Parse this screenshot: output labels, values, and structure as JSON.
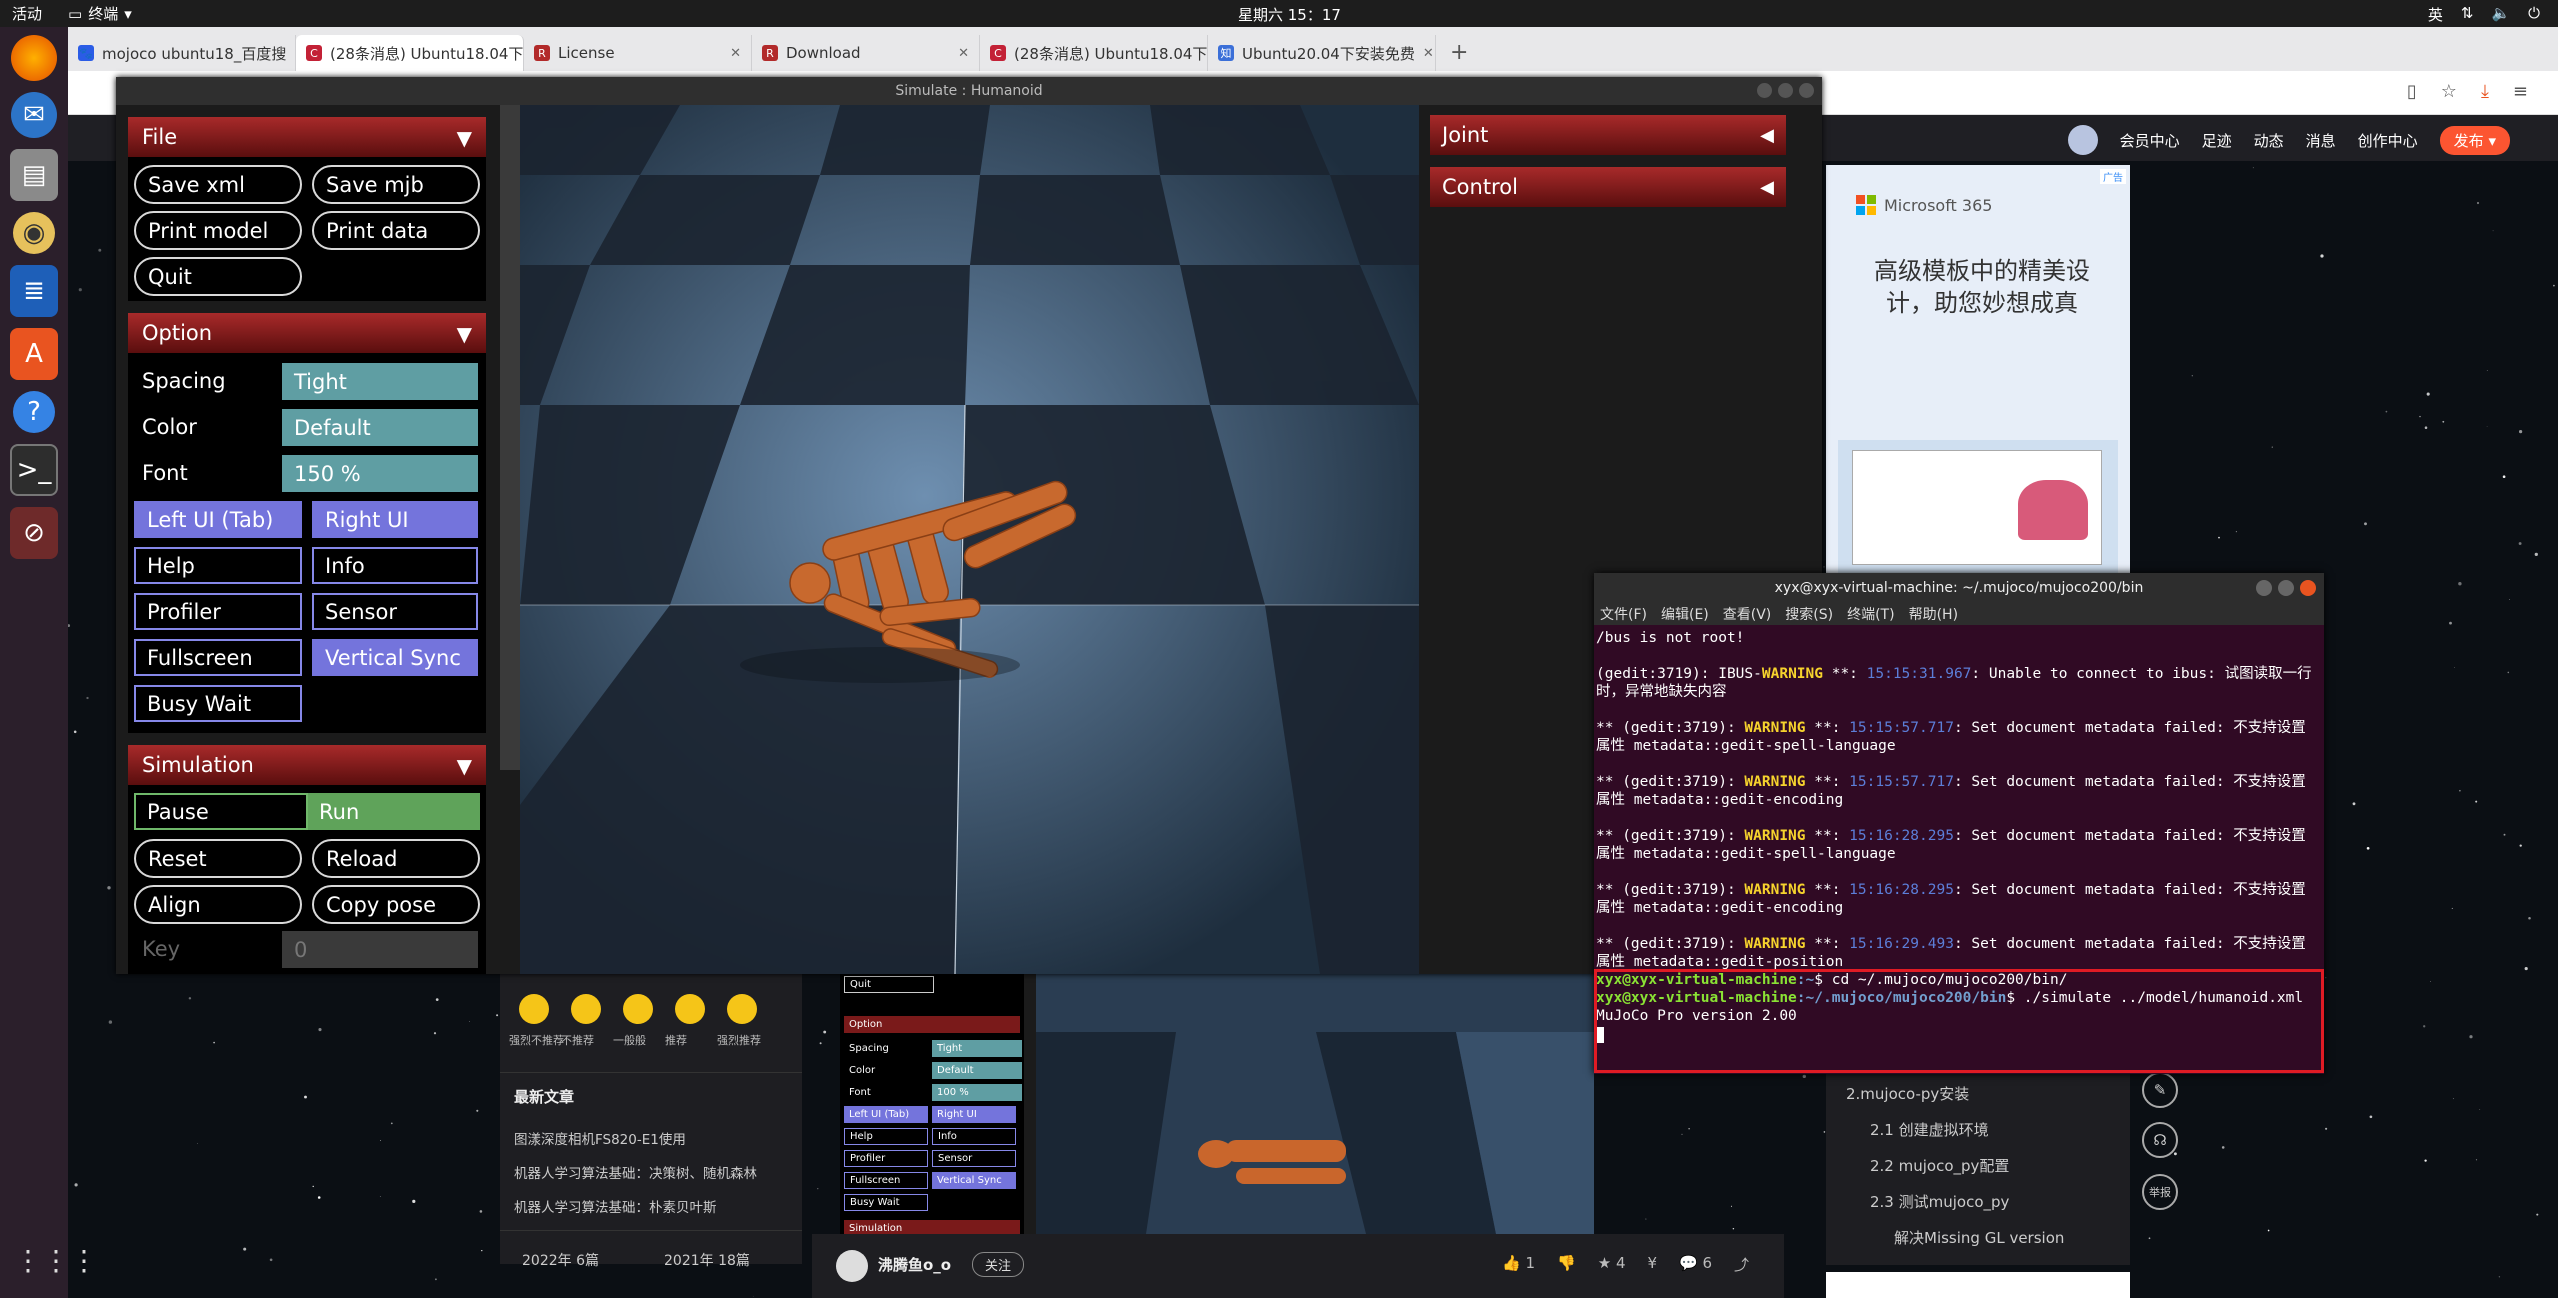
{
  "topbar": {
    "activities": "活动",
    "terminal_app": "终端",
    "clock": "星期六 15：17",
    "ime": "英"
  },
  "browser": {
    "tabs": [
      {
        "label": "mojoco ubuntu18_百度搜",
        "fav_color": "#2b5ce6",
        "fav": "🐾"
      },
      {
        "label": "(28条消息) Ubuntu18.04下",
        "fav_color": "#c32136",
        "fav": "C",
        "active": true
      },
      {
        "label": "License",
        "fav_color": "#b22a2a",
        "fav": "R"
      },
      {
        "label": "Download",
        "fav_color": "#b22a2a",
        "fav": "R"
      },
      {
        "label": "(28条消息) Ubuntu18.04下",
        "fav_color": "#c32136",
        "fav": "C"
      },
      {
        "label": "Ubuntu20.04下安装免费",
        "fav_color": "#3b6fd8",
        "fav": "知"
      }
    ]
  },
  "csdn": {
    "nav": [
      "会员中心",
      "足迹",
      "动态",
      "消息",
      "创作中心"
    ],
    "publish": "发布"
  },
  "sim": {
    "title": "Simulate : Humanoid",
    "file": {
      "header": "File",
      "buttons": [
        "Save xml",
        "Save mjb",
        "Print model",
        "Print data",
        "Quit"
      ]
    },
    "option": {
      "header": "Option",
      "rows": [
        {
          "label": "Spacing",
          "value": "Tight"
        },
        {
          "label": "Color",
          "value": "Default"
        },
        {
          "label": "Font",
          "value": "150 %"
        }
      ],
      "toggles": [
        "Left UI (Tab)",
        "Right UI",
        "Help",
        "Info",
        "Profiler",
        "Sensor",
        "Fullscreen",
        "Vertical Sync",
        "Busy Wait"
      ]
    },
    "simulation": {
      "header": "Simulation",
      "pause": "Pause",
      "run": "Run",
      "buttons": [
        "Reset",
        "Reload",
        "Align",
        "Copy pose"
      ],
      "key_label": "Key",
      "key_value": "0"
    },
    "right": {
      "joint": "Joint",
      "control": "Control"
    }
  },
  "ad": {
    "badge": "广告",
    "brand": "Microsoft 365",
    "title": "高级模板中的精美设计，助您妙想成真"
  },
  "toc": {
    "items": [
      "2.mujoco-py安装",
      "2.1 创建虚拟环境",
      "2.2 mujoco_py配置",
      "2.3 测试mujoco_py",
      "解决Missing GL version"
    ]
  },
  "side_tools": {
    "report": "举报"
  },
  "article_left": {
    "ratings": [
      "强烈不推荐",
      "不推荐",
      "一般般",
      "推荐",
      "强烈推荐"
    ],
    "recent_title": "最新文章",
    "recent": [
      "图漾深度相机FS820-E1使用",
      "机器人学习算法基础：决策树、随机森林",
      "机器人学习算法基础：朴素贝叶斯"
    ],
    "archive": [
      "2022年  6篇",
      "2021年  18篇"
    ]
  },
  "mini": {
    "rows": [
      "Quit",
      "Option",
      "Spacing",
      "Tight",
      "Color",
      "Default",
      "Font",
      "100 %",
      "Left UI (Tab)",
      "Right UI",
      "Help",
      "Info",
      "Profiler",
      "Sensor",
      "Fullscreen",
      "Vertical Sync",
      "Busy Wait",
      "Simulation"
    ]
  },
  "combar": {
    "author": "沸腾鱼o_o",
    "follow": "关注",
    "likes": "1",
    "stars": "4",
    "comments": "6"
  },
  "terminal": {
    "title": "xyx@xyx-virtual-machine: ~/.mujoco/mujoco200/bin",
    "menu": [
      "文件(F)",
      "编辑(E)",
      "查看(V)",
      "搜索(S)",
      "终端(T)",
      "帮助(H)"
    ],
    "l0": "/bus is not root!",
    "l1a": "(gedit:3719): IBUS-",
    "l1w": "WARNING",
    "l1b": " **: ",
    "l1t": "15:15:31.967",
    "l1c": ": Unable to connect to ibus: 试图读取一行时，异常地缺失内容",
    "warnings": [
      {
        "pre": "** (gedit:3719): ",
        "ts": "15:15:57.717",
        "msg": ": Set document metadata failed: 不支持设置属性 metadata::gedit-spell-language"
      },
      {
        "pre": "** (gedit:3719): ",
        "ts": "15:15:57.717",
        "msg": ": Set document metadata failed: 不支持设置属性 metadata::gedit-encoding"
      },
      {
        "pre": "** (gedit:3719): ",
        "ts": "15:16:28.295",
        "msg": ": Set document metadata failed: 不支持设置属性 metadata::gedit-spell-language"
      },
      {
        "pre": "** (gedit:3719): ",
        "ts": "15:16:28.295",
        "msg": ": Set document metadata failed: 不支持设置属性 metadata::gedit-encoding"
      },
      {
        "pre": "** (gedit:3719): ",
        "ts": "15:16:29.493",
        "msg": ": Set document metadata failed: 不支持设置属性 metadata::gedit-position"
      }
    ],
    "warning_word": "WARNING",
    "prompt_user": "xyx@xyx-virtual-machine",
    "prompt1_path": ":~",
    "cmd1": "$ cd ~/.mujoco/mujoco200/bin/",
    "prompt2_path": ":~/.mujoco/mujoco200/bin",
    "cmd2": "$ ./simulate ../model/humanoid.xml",
    "out": "MuJoCo Pro version 2.00"
  }
}
